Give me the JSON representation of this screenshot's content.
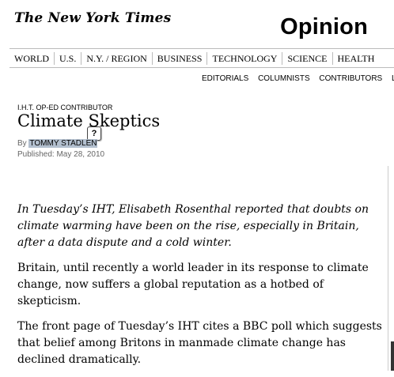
{
  "masthead": {
    "logo_text": "The New York Times",
    "section": "Opinion"
  },
  "topnav": [
    "WORLD",
    "U.S.",
    "N.Y. / REGION",
    "BUSINESS",
    "TECHNOLOGY",
    "SCIENCE",
    "HEALTH"
  ],
  "subnav": [
    "EDITORIALS",
    "COLUMNISTS",
    "CONTRIBUTORS",
    "L"
  ],
  "article": {
    "kicker": "I.H.T. OP-ED CONTRIBUTOR",
    "headline": "Climate Skeptics",
    "help_glyph": "?",
    "byline_prefix": "By",
    "author": "TOMMY STADLEN",
    "published": "Published: May 28, 2010",
    "paragraphs": [
      "In Tuesday’s IHT, Elisabeth Rosenthal reported that doubts on climate warming have been on the rise, especially in Britain, after a data dispute and a cold winter.",
      "Britain, until recently a world leader in its response to climate change, now suffers a global reputation as a hotbed of skepticism.",
      "The front page of Tuesday’s IHT cites a BBC poll which suggests that belief among Britons in manmade climate change has declined dramatically."
    ]
  }
}
